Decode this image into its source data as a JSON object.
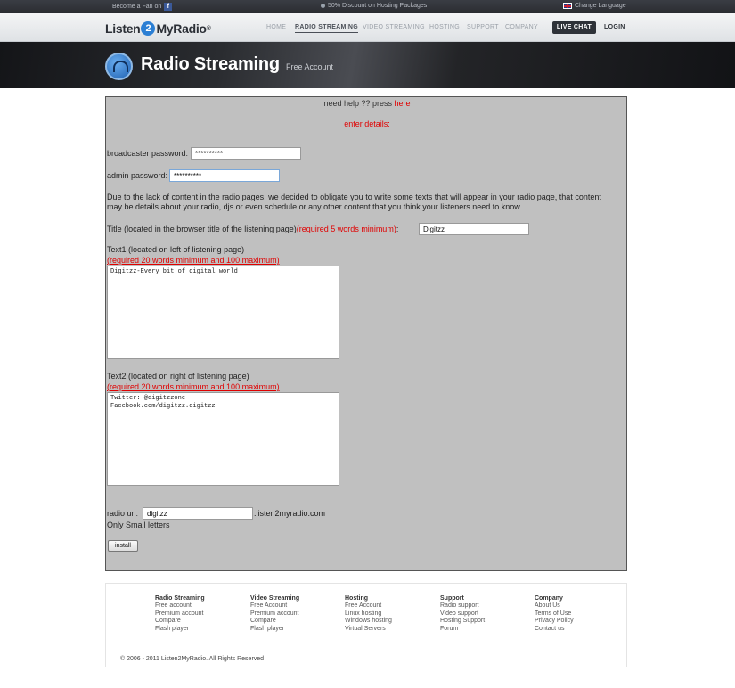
{
  "topbar": {
    "fan_label": "Become a Fan on",
    "promo_label": "50% Discount on Hosting Packages",
    "language_label": "Change Language",
    "icons": [
      "facebook-icon",
      "promo-icon",
      "uk-flag-icon"
    ]
  },
  "header": {
    "logo_left": "Listen",
    "logo_mark": "2",
    "logo_right": "MyRadio",
    "logo_reg": "®",
    "nav": [
      "HOME",
      "RADIO STREAMING",
      "VIDEO STREAMING",
      "HOSTING",
      "SUPPORT",
      "COMPANY"
    ],
    "active_nav": "RADIO STREAMING",
    "live_chat": "LIVE CHAT",
    "login": "LOGIN"
  },
  "hero": {
    "title": "Radio Streaming",
    "subtitle": "Free Account",
    "icon": "headphones-icon"
  },
  "form": {
    "help_text": "need help ?? press",
    "help_link": "here",
    "enter_details": "enter details:",
    "broadcaster_label": "broadcaster password:",
    "broadcaster_value": "**********",
    "admin_label": "admin password:",
    "admin_value": "**********",
    "notice": "Due to the lack of content in the radio pages, we decided to obligate you to write some texts that will appear in your radio page, that content may be details about your radio, djs or even schedule or any other content that you think your listeners need to know.",
    "title_label": "Title (located in the browser title of the listening page)",
    "title_req": "(required 5 words minimum)",
    "title_colon": ":",
    "title_value": "Digitzz",
    "text1_label": "Text1 (located on left of listening page)",
    "text1_req": "(required 20 words minimum and 100 maximum)",
    "text1_value": "Digitzz-Every bit of digital world",
    "text2_label": "Text2 (located on right of listening page)",
    "text2_req": "(required 20 words minimum and 100 maximum)",
    "text2_value": "Twitter: @digitzzone\nFacebook.com/digitzz.digitzz",
    "url_label": "radio url:",
    "url_value": "digitzz",
    "url_suffix": ".listen2myradio.com",
    "url_hint": "Only Small letters",
    "install": "install"
  },
  "footer": {
    "columns": [
      {
        "heading": "Radio Streaming",
        "links": [
          "Free account",
          "Premium account",
          "Compare",
          "Flash player"
        ]
      },
      {
        "heading": "Video Streaming",
        "links": [
          "Free Account",
          "Premium account",
          "Compare",
          "Flash player"
        ]
      },
      {
        "heading": "Hosting",
        "links": [
          "Free Account",
          "Linux hosting",
          "Windows hosting",
          "Virtual Servers"
        ]
      },
      {
        "heading": "Support",
        "links": [
          "Radio support",
          "Video support",
          "Hosting Support",
          "Forum"
        ]
      },
      {
        "heading": "Company",
        "links": [
          "About Us",
          "Terms of Use",
          "Privacy Policy",
          "Contact us"
        ]
      }
    ],
    "copyright": "© 2006 - 2011 Listen2MyRadio. All Rights Reserved"
  }
}
